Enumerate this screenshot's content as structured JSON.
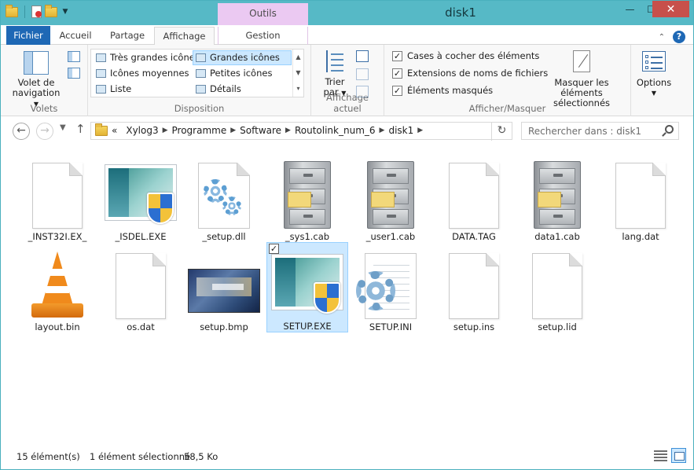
{
  "window": {
    "title": "disk1",
    "contextual_tab": "Outils d'application",
    "minimize_glyph": "—",
    "maximize_glyph": "☐",
    "close_glyph": "✕"
  },
  "ribbon_tabs": {
    "file": "Fichier",
    "home": "Accueil",
    "share": "Partage",
    "view": "Affichage",
    "manage": "Gestion"
  },
  "ribbon": {
    "panes": {
      "nav_pane_label_1": "Volet de",
      "nav_pane_label_2": "navigation",
      "group_label": "Volets"
    },
    "layout": {
      "items": [
        "Très grandes icônes",
        "Grandes icônes",
        "Icônes moyennes",
        "Petites icônes",
        "Liste",
        "Détails"
      ],
      "selected": "Grandes icônes",
      "group_label": "Disposition"
    },
    "current_view": {
      "sort_label_1": "Trier",
      "sort_label_2": "par",
      "group_label": "Affichage actuel"
    },
    "show_hide": {
      "checkboxes": [
        {
          "label": "Cases à cocher des éléments",
          "checked": true
        },
        {
          "label": "Extensions de noms de fichiers",
          "checked": true
        },
        {
          "label": "Éléments masqués",
          "checked": true
        }
      ],
      "hide_selected_1": "Masquer les éléments",
      "hide_selected_2": "sélectionnés",
      "group_label": "Afficher/Masquer"
    },
    "options_label": "Options"
  },
  "address": {
    "overflow": "«",
    "breadcrumbs": [
      "Xylog3",
      "Programme",
      "Software",
      "Routolink_num_6",
      "disk1"
    ],
    "search_placeholder": "Rechercher dans : disk1"
  },
  "files": [
    {
      "name": "_INST32I.EX_",
      "icon": "blank-document-icon"
    },
    {
      "name": "_ISDEL.EXE",
      "icon": "installer-exe-icon"
    },
    {
      "name": "_setup.dll",
      "icon": "dll-gear-icon"
    },
    {
      "name": "_sys1.cab",
      "icon": "filing-cabinet-icon"
    },
    {
      "name": "_user1.cab",
      "icon": "filing-cabinet-icon"
    },
    {
      "name": "DATA.TAG",
      "icon": "blank-document-icon"
    },
    {
      "name": "data1.cab",
      "icon": "filing-cabinet-icon"
    },
    {
      "name": "lang.dat",
      "icon": "blank-document-icon"
    },
    {
      "name": "layout.bin",
      "icon": "vlc-cone-icon"
    },
    {
      "name": "os.dat",
      "icon": "blank-document-icon"
    },
    {
      "name": "setup.bmp",
      "icon": "bitmap-thumbnail-icon"
    },
    {
      "name": "SETUP.EXE",
      "icon": "installer-exe-icon",
      "selected": true
    },
    {
      "name": "SETUP.INI",
      "icon": "ini-settings-icon"
    },
    {
      "name": "setup.ins",
      "icon": "blank-document-icon"
    },
    {
      "name": "setup.lid",
      "icon": "blank-document-icon"
    }
  ],
  "status": {
    "count": "15 élément(s)",
    "selected": "1 élément sélectionné",
    "size": "58,5 Ko"
  },
  "colors": {
    "title_bar": "#56b9c6",
    "file_tab": "#1e68b5",
    "contextual": "#ebc9f2",
    "selection": "#cce8ff",
    "close": "#c7504b"
  }
}
